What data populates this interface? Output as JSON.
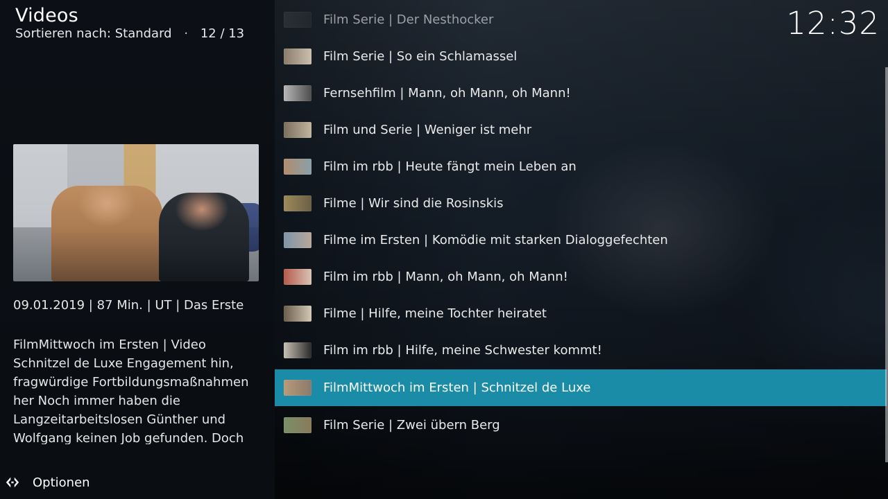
{
  "header": {
    "title": "Videos",
    "sort_label": "Sortieren nach: Standard",
    "position": "12 / 13"
  },
  "clock": "12:32",
  "selected": {
    "meta": "09.01.2019 | 87 Min. | UT | Das Erste",
    "plot": "FilmMittwoch im Ersten | Video\nSchnitzel de Luxe  Engagement hin,\nfragwürdige Fortbildungsmaßnahmen\nher  Noch immer haben die\nLangzeitarbeitslosen Günther und\nWolfgang keinen Job gefunden. Doch"
  },
  "footer": {
    "options_label": "Optionen",
    "icon": "options-arrows-icon"
  },
  "list": {
    "items": [
      {
        "label": "Film Serie | Der Nesthocker",
        "state": "dim"
      },
      {
        "label": "Film Serie | So ein Schlamassel",
        "state": "normal"
      },
      {
        "label": "Fernsehfilm | Mann, oh Mann, oh Mann!",
        "state": "normal"
      },
      {
        "label": "Film und Serie | Weniger ist mehr",
        "state": "normal"
      },
      {
        "label": "Film im rbb | Heute fängt mein Leben an",
        "state": "normal"
      },
      {
        "label": "Filme | Wir sind die Rosinskis",
        "state": "normal"
      },
      {
        "label": "Filme im Ersten | Komödie mit starken Dialoggefechten",
        "state": "normal"
      },
      {
        "label": "Film im rbb | Mann, oh Mann, oh Mann!",
        "state": "normal"
      },
      {
        "label": "Filme | Hilfe, meine Tochter heiratet",
        "state": "normal"
      },
      {
        "label": "Film im rbb | Hilfe, meine Schwester kommt!",
        "state": "normal"
      },
      {
        "label": "FilmMittwoch im Ersten | Schnitzel de Luxe",
        "state": "selected"
      },
      {
        "label": "Film Serie | Zwei übern Berg",
        "state": "normal"
      }
    ]
  },
  "colors": {
    "selection": "#1b8ca8"
  }
}
